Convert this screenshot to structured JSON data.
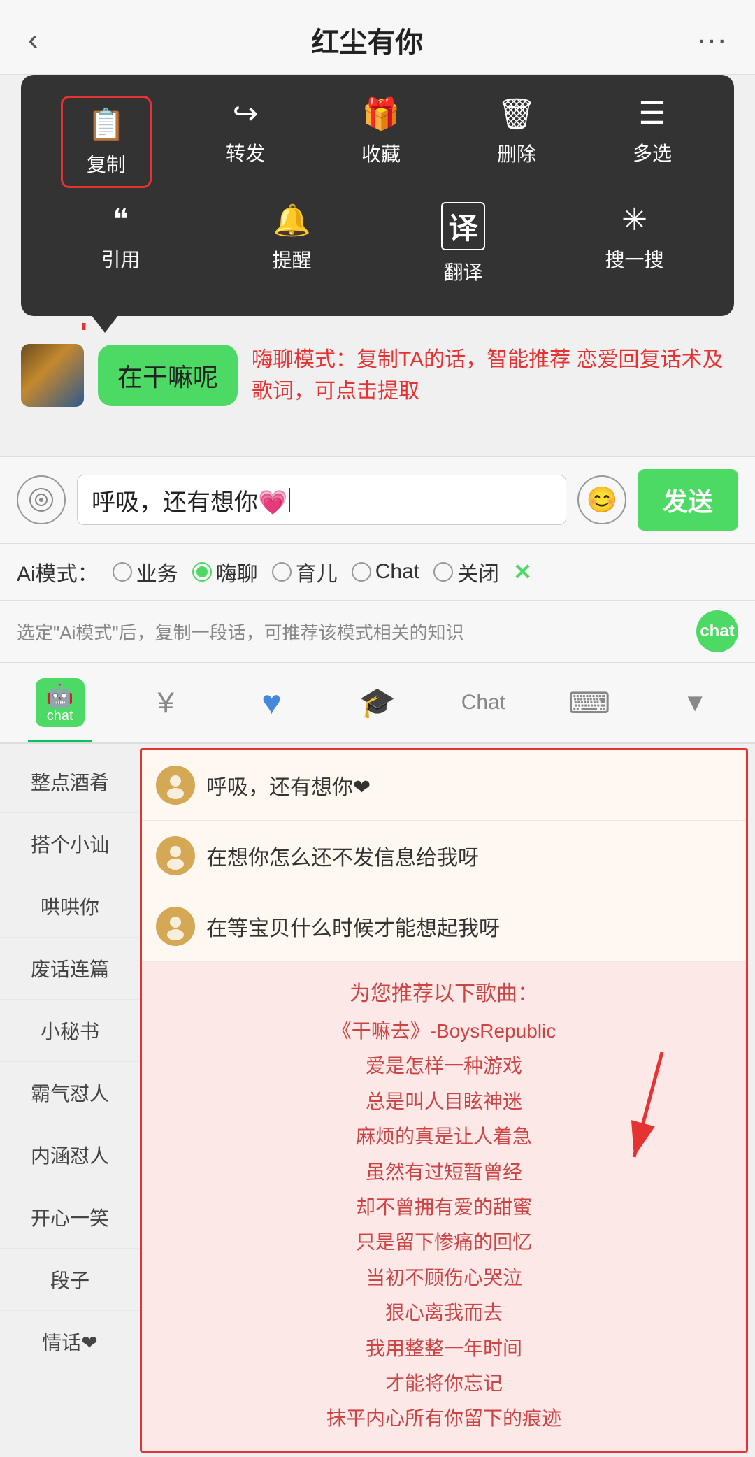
{
  "header": {
    "back_label": "‹",
    "title": "红尘有你",
    "more_label": "···"
  },
  "context_menu": {
    "row1": [
      {
        "id": "copy",
        "icon": "📄",
        "label": "复制",
        "highlighted": true
      },
      {
        "id": "forward",
        "icon": "↪",
        "label": "转发",
        "highlighted": false
      },
      {
        "id": "collect",
        "icon": "🎁",
        "label": "收藏",
        "highlighted": false
      },
      {
        "id": "delete",
        "icon": "🗑",
        "label": "删除",
        "highlighted": false
      },
      {
        "id": "multiselect",
        "icon": "☰",
        "label": "多选",
        "highlighted": false
      }
    ],
    "row2": [
      {
        "id": "quote",
        "icon": "❝",
        "label": "引用",
        "highlighted": false
      },
      {
        "id": "remind",
        "icon": "🔔",
        "label": "提醒",
        "highlighted": false
      },
      {
        "id": "translate",
        "icon": "译",
        "label": "翻译",
        "highlighted": false
      },
      {
        "id": "search",
        "icon": "✳",
        "label": "搜一搜",
        "highlighted": false
      }
    ]
  },
  "chat_hint": "嗨聊模式：复制TA的话，智能推荐\n恋爱回复话术及歌词，可点击提取",
  "chat_message": "在干嘛呢",
  "input_field": {
    "value": "呼吸，还有想你💗",
    "placeholder": "呼吸，还有想你💗"
  },
  "send_button": "发送",
  "ai_mode": {
    "label": "Ai模式：",
    "options": [
      {
        "id": "business",
        "label": "业务",
        "active": false
      },
      {
        "id": "haichat",
        "label": "嗨聊",
        "active": true
      },
      {
        "id": "parenting",
        "label": "育儿",
        "active": false
      },
      {
        "id": "chat",
        "label": "Chat",
        "active": false
      },
      {
        "id": "off",
        "label": "关闭",
        "active": false
      }
    ],
    "close": "✕"
  },
  "ai_hint_bar": {
    "text": "选定\"Ai模式\"后，复制一段话，可推荐该模式相关的知识"
  },
  "tabs": [
    {
      "id": "robot",
      "type": "robot",
      "active": true
    },
    {
      "id": "money",
      "icon": "¥",
      "active": false
    },
    {
      "id": "heart",
      "icon": "♥",
      "active": false
    },
    {
      "id": "school",
      "icon": "🎓",
      "active": false
    },
    {
      "id": "chat",
      "label": "Chat",
      "active": false
    },
    {
      "id": "keyboard",
      "icon": "⌨",
      "active": false
    },
    {
      "id": "down",
      "icon": "▼",
      "active": false
    }
  ],
  "sidebar": {
    "items": [
      {
        "id": "bar",
        "label": "整点酒肴"
      },
      {
        "id": "hang",
        "label": "搭个小讪"
      },
      {
        "id": "coax",
        "label": "哄哄你"
      },
      {
        "id": "nonsense",
        "label": "废话连篇"
      },
      {
        "id": "secretary",
        "label": "小秘书"
      },
      {
        "id": "domineering",
        "label": "霸气怼人"
      },
      {
        "id": "connotation",
        "label": "内涵怼人"
      },
      {
        "id": "laugh",
        "label": "开心一笑"
      },
      {
        "id": "paragraph",
        "label": "段子"
      },
      {
        "id": "love_talk",
        "label": "情话❤"
      }
    ]
  },
  "suggestions": [
    {
      "id": "s1",
      "text": "呼吸，还有想你❤"
    },
    {
      "id": "s2",
      "text": "在想你怎么还不发信息给我呀"
    },
    {
      "id": "s3",
      "text": "在等宝贝什么时候才能想起我呀"
    }
  ],
  "song_section": {
    "title": "为您推荐以下歌曲：",
    "lines": [
      "《干嘛去》-BoysRepublic",
      "爱是怎样一种游戏",
      "总是叫人目眩神迷",
      "麻烦的真是让人着急",
      "虽然有过短暂曾经",
      "却不曾拥有爱的甜蜜",
      "只是留下惨痛的回忆",
      "当初不顾伤心哭泣",
      "狠心离我而去",
      "我用整整一年时间",
      "才能将你忘记",
      "抹平内心所有你留下的痕迹"
    ]
  }
}
